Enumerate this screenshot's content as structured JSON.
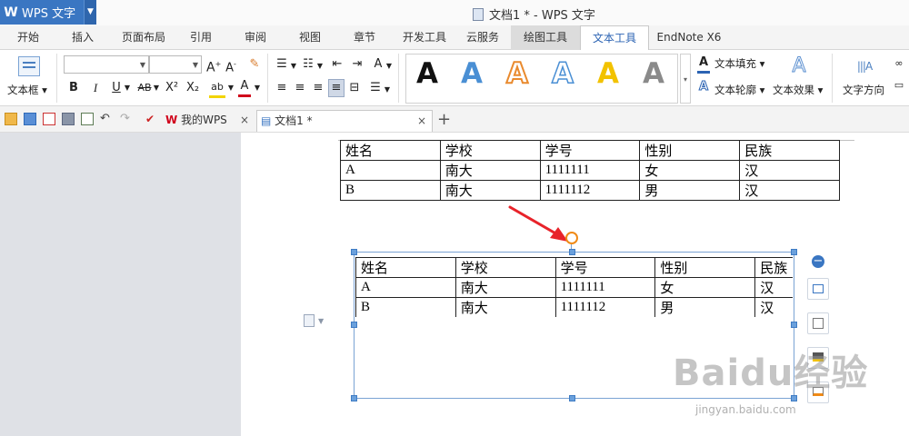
{
  "app": {
    "name": "WPS 文字",
    "logo_letter": "W"
  },
  "window": {
    "title": "文档1 * - WPS 文字"
  },
  "tabs": [
    "开始",
    "插入",
    "页面布局",
    "引用",
    "审阅",
    "视图",
    "章节",
    "开发工具",
    "云服务",
    "绘图工具",
    "文本工具",
    "EndNote X6"
  ],
  "active_tab": "文本工具",
  "ribbon": {
    "textbox_label": "文本框",
    "font_name": "",
    "font_size": "",
    "format_buttons": [
      "B",
      "I",
      "U",
      "AB",
      "X²",
      "X₂"
    ],
    "text_fill_label": "文本填充",
    "text_outline_label": "文本轮廓",
    "text_effect_label": "文本效果",
    "text_direction_label": "文字方向",
    "style_colors": [
      "#111111",
      "#4a8fd4",
      "#e98a2e",
      "#4a8fd4",
      "#f2c200",
      "#8a8a8a"
    ]
  },
  "doc_tabs": [
    {
      "label": "我的WPS",
      "close": "×"
    },
    {
      "label": "文档1 *",
      "close": "×"
    }
  ],
  "new_tab": "+",
  "table1": {
    "header": [
      "姓名",
      "学校",
      "学号",
      "性别",
      "民族"
    ],
    "rows": [
      [
        "A",
        "南大",
        "1111111",
        "女",
        "汉"
      ],
      [
        "B",
        "南大",
        "1111112",
        "男",
        "汉"
      ]
    ]
  },
  "table2": {
    "header": [
      "姓名",
      "学校",
      "学号",
      "性别",
      "民族"
    ],
    "rows": [
      [
        "A",
        "南大",
        "1111111",
        "女",
        "汉"
      ],
      [
        "B",
        "南大",
        "1111112",
        "男",
        "汉"
      ]
    ]
  },
  "watermark": {
    "brand": "Baidu经验",
    "url": "jingyan.baidu.com"
  }
}
